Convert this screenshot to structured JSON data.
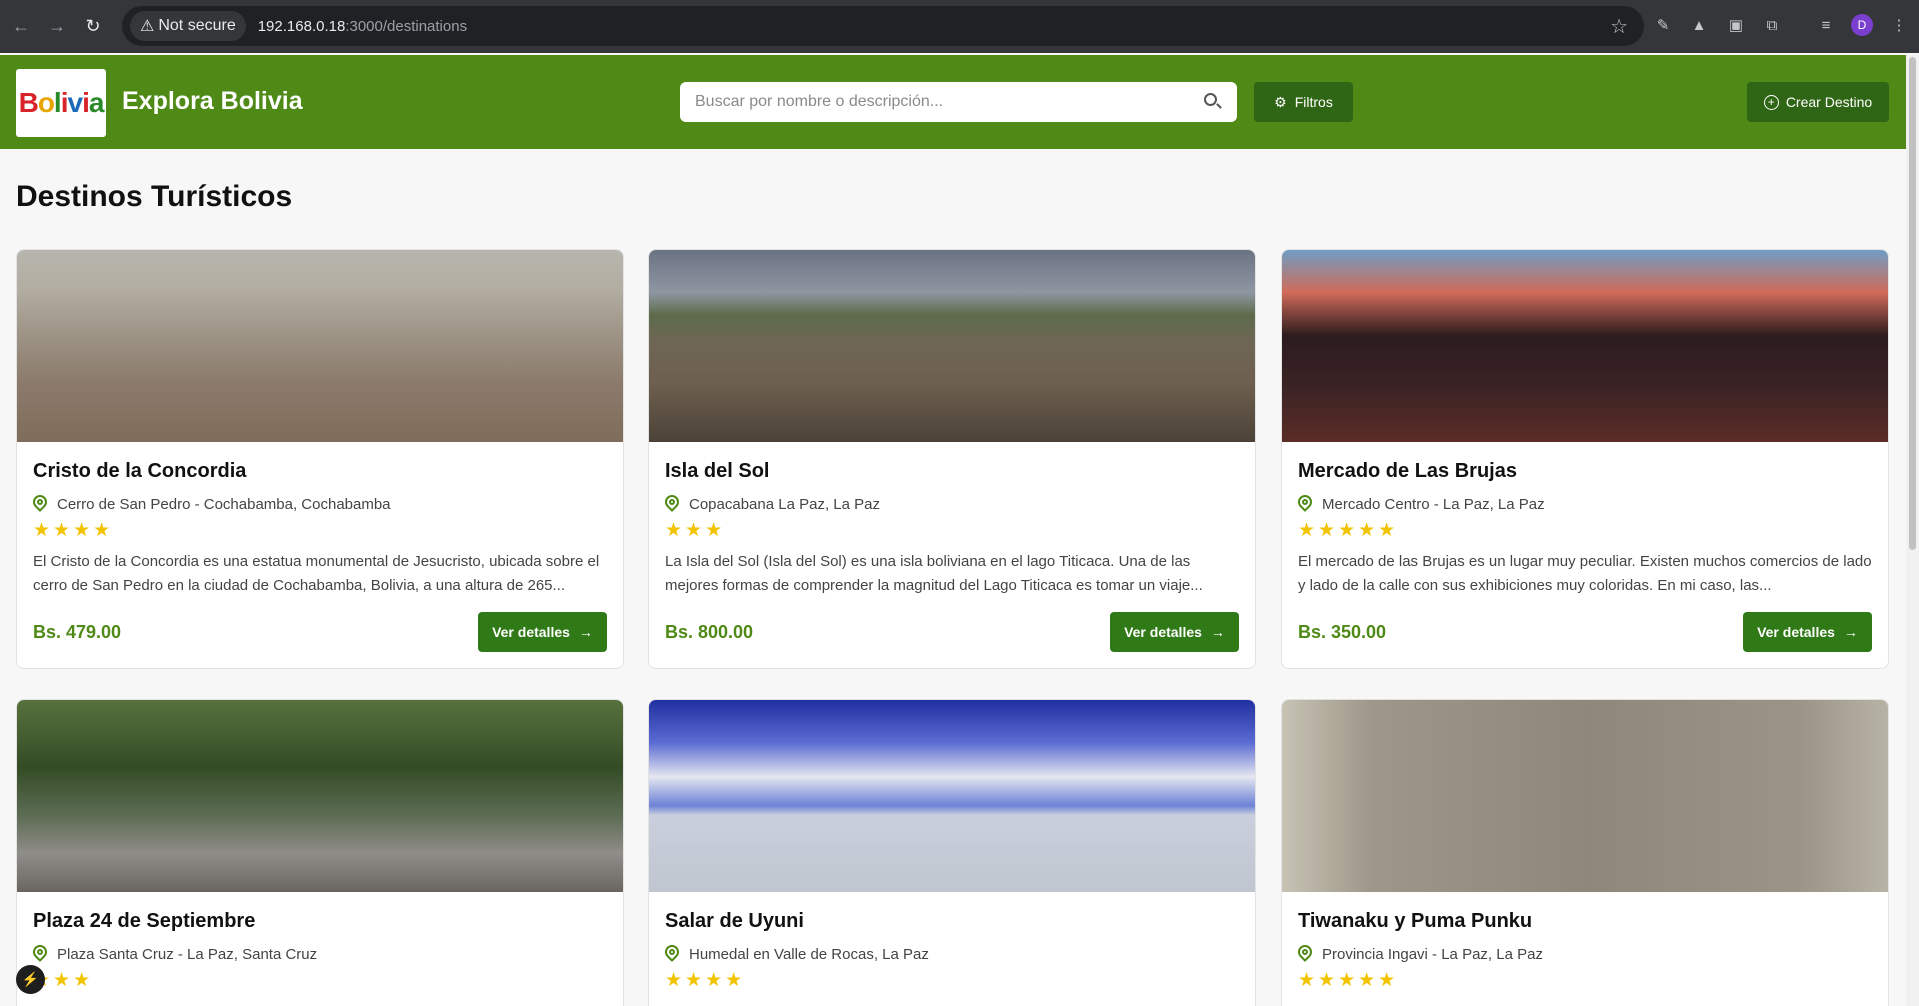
{
  "browser": {
    "security_label": "Not secure",
    "url_host": "192.168.0.18",
    "url_path": ":3000/destinations",
    "avatar_initial": "D"
  },
  "header": {
    "logo_text": "Bolivia",
    "title": "Explora Bolivia",
    "search_placeholder": "Buscar por nombre o descripción...",
    "filters_label": "Filtros",
    "create_label": "Crear Destino"
  },
  "main": {
    "title": "Destinos Turísticos"
  },
  "colors": {
    "header_bg": "#4f8a17",
    "button_bg": "#2f7a16",
    "price": "#4f8a17",
    "stars": "#f2c400"
  },
  "destinations": [
    {
      "title": "Cristo de la Concordia",
      "location": "Cerro de San Pedro - Cochabamba, Cochabamba",
      "rating": 4,
      "stars": "★★★★",
      "description": "El Cristo de la Concordia es una estatua monumental de Jesucristo, ubicada sobre el cerro de San Pedro en la ciudad de Cochabamba, Bolivia, a una altura de 265...",
      "price": "Bs. 479.00",
      "button": "Ver detalles"
    },
    {
      "title": "Isla del Sol",
      "location": "Copacabana La Paz, La Paz",
      "rating": 3,
      "stars": "★★★",
      "description": "La Isla del Sol (Isla del Sol) es una isla boliviana en el lago Titicaca. Una de las mejores formas de comprender la magnitud del Lago Titicaca es tomar un viaje...",
      "price": "Bs. 800.00",
      "button": "Ver detalles"
    },
    {
      "title": "Mercado de Las Brujas",
      "location": "Mercado Centro - La Paz, La Paz",
      "rating": 5,
      "stars": "★★★★★",
      "description": "El mercado de las Brujas es un lugar muy peculiar. Existen muchos comercios de lado y lado de la calle con sus exhibiciones muy coloridas. En mi caso, las...",
      "price": "Bs. 350.00",
      "button": "Ver detalles"
    },
    {
      "title": "Plaza 24 de Septiembre",
      "location": "Plaza Santa Cruz - La Paz, Santa Cruz",
      "rating": 3,
      "stars": "★★★"
    },
    {
      "title": "Salar de Uyuni",
      "location": "Humedal en Valle de Rocas, La Paz",
      "rating": 4,
      "stars": "★★★★"
    },
    {
      "title": "Tiwanaku y Puma Punku",
      "location": "Provincia Ingavi - La Paz, La Paz",
      "rating": 5,
      "stars": "★★★★★"
    }
  ]
}
